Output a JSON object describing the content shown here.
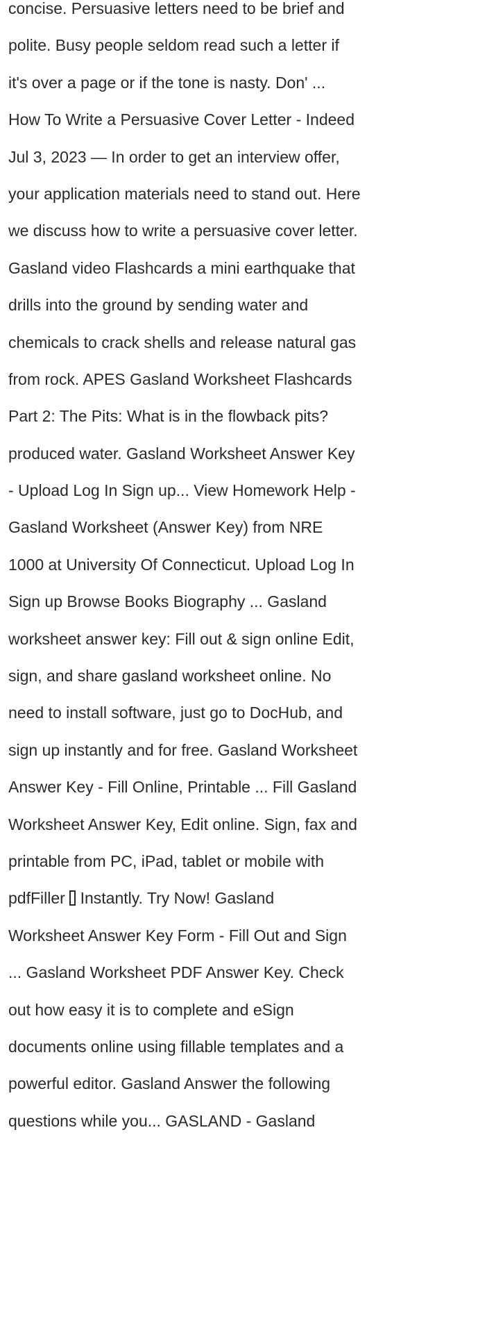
{
  "article": {
    "lines": [
      "concise. Persuasive letters need to be brief and",
      "polite. Busy people seldom read such a letter if",
      "it's over a page or if the tone is nasty. Don' ...",
      "How To Write a Persuasive Cover Letter - Indeed",
      "Jul 3, 2023 — In order to get an interview offer,",
      "your application materials need to stand out. Here",
      "we discuss how to write a persuasive cover letter.",
      "Gasland video Flashcards a mini earthquake that",
      "drills into the ground by sending water and",
      "chemicals to crack shells and release natural gas",
      "from rock. APES Gasland Worksheet Flashcards",
      "Part 2: The Pits: What is in the flowback pits?",
      "produced water. Gasland Worksheet Answer Key",
      "- Upload Log In Sign up... View Homework Help -",
      "Gasland Worksheet (Answer Key) from NRE",
      "1000 at University Of Connecticut. Upload Log In",
      "Sign up Browse Books Biography ... Gasland",
      "worksheet answer key: Fill out & sign online Edit,",
      "sign, and share gasland worksheet online. No",
      "need to install software, just go to DocHub, and",
      "sign up instantly and for free. Gasland Worksheet",
      "Answer Key - Fill Online, Printable ... Fill Gasland",
      "Worksheet Answer Key, Edit online. Sign, fax and",
      "printable from PC, iPad, tablet or mobile with"
    ],
    "line_pdffiller_before": "pdfFiller ",
    "line_pdffiller_after": " Instantly. Try Now! Gasland",
    "lines_after": [
      "Worksheet Answer Key Form - Fill Out and Sign",
      "... Gasland Worksheet PDF Answer Key. Check",
      "out how easy it is to complete and eSign",
      "documents online using fillable templates and a",
      "powerful editor. Gasland Answer the following",
      "questions while you... GASLAND - Gasland"
    ]
  }
}
